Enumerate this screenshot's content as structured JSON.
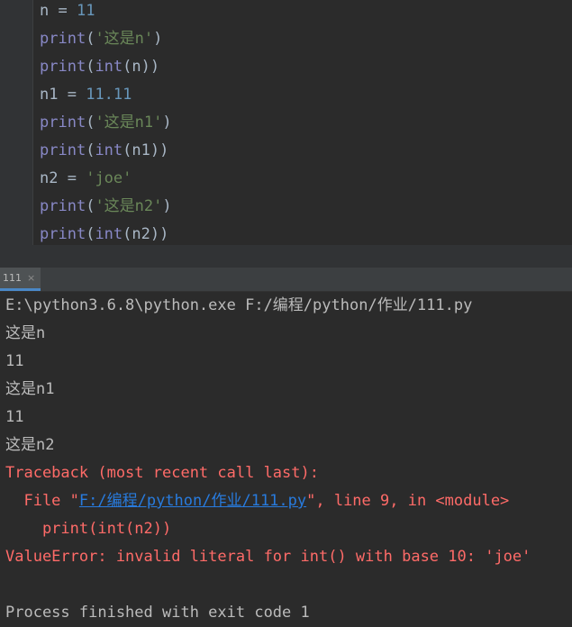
{
  "editor": {
    "lines": [
      {
        "var": "n",
        "op": " = ",
        "value": "11"
      },
      {
        "fn": "print",
        "open": "(",
        "str": "'这是n'",
        "close": ")"
      },
      {
        "fn": "print",
        "open": "(",
        "fn2": "int",
        "inner": "(n))"
      },
      {
        "var": "n1",
        "op": " = ",
        "value": "11.11"
      },
      {
        "fn": "print",
        "open": "(",
        "str": "'这是n1'",
        "close": ")"
      },
      {
        "fn": "print",
        "open": "(",
        "fn2": "int",
        "inner": "(n1))"
      },
      {
        "var": "n2",
        "op": " = ",
        "str": "'joe'"
      },
      {
        "fn": "print",
        "open": "(",
        "str": "'这是n2'",
        "close": ")"
      },
      {
        "fn": "print",
        "open": "(",
        "fn2": "int",
        "inner": "(n2))"
      }
    ]
  },
  "run_tab": {
    "label": "111",
    "close_glyph": "×"
  },
  "console": {
    "command": "E:\\python3.6.8\\python.exe F:/编程/python/作业/111.py",
    "outputs": [
      "这是n",
      "11",
      "这是n1",
      "11",
      "这是n2"
    ],
    "traceback_header": "Traceback (most recent call last):",
    "file_prefix": "  File \"",
    "file_link": "F:/编程/python/作业/111.py",
    "file_suffix": "\", line 9, in <module>",
    "error_code": "    print(int(n2))",
    "error_message": "ValueError: invalid literal for int() with base 10: 'joe'",
    "exit_message": "Process finished with exit code 1"
  },
  "colors": {
    "background": "#2b2b2b",
    "keyword_builtin": "#8888c6",
    "number": "#6897bb",
    "string": "#6a8759",
    "error": "#ff6b68",
    "link": "#287bde"
  }
}
